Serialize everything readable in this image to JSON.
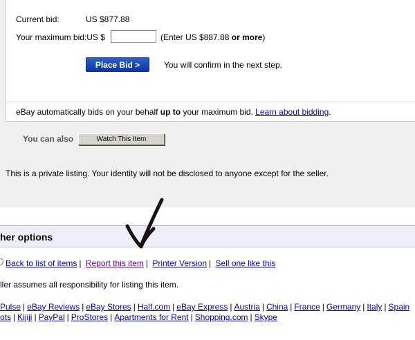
{
  "bid": {
    "current_bid_label": "Current bid:",
    "current_bid_value": "US $877.88",
    "max_bid_label": "Your maximum bid:US $",
    "max_bid_value": "",
    "max_bid_hint_prefix": "(Enter US $887.88 ",
    "max_bid_hint_bold": "or more",
    "max_bid_hint_suffix": ")",
    "place_bid_label": "Place Bid >",
    "confirm_note": "You will confirm in the next step.",
    "auto_bid_prefix": "eBay automatically bids on your behalf ",
    "auto_bid_bold": "up to",
    "auto_bid_suffix": " your maximum bid. ",
    "learn_link": "Learn about bidding",
    "learn_after": "."
  },
  "also": {
    "label": "You can also",
    "watch_button": "Watch This Item"
  },
  "private_note": "This is a private listing. Your identity will not be disclosed to anyone except for the seller.",
  "other_options": {
    "title": "her options",
    "links": [
      "Back to list of items",
      "Report this item",
      "Printer Version",
      "Sell one like this"
    ],
    "seller_note": "ller assumes all responsibility for listing this item."
  },
  "footer": {
    "row1": [
      "Pulse",
      "eBay Reviews",
      "eBay Stores",
      "Half.com",
      "eBay Express",
      "Austria",
      "China",
      "France",
      "Germany",
      "Italy",
      "Spain"
    ],
    "row2": [
      "ots",
      "Kijiji",
      "PayPal",
      "ProStores",
      "Apartments for Rent",
      "Shopping.com",
      "Skype"
    ]
  },
  "colors": {
    "link": "#0000cc",
    "visited_link": "#660099",
    "place_bid_bg": "#0b36a6",
    "panel_bg": "#efefef",
    "header_bg": "#eeeefa"
  }
}
